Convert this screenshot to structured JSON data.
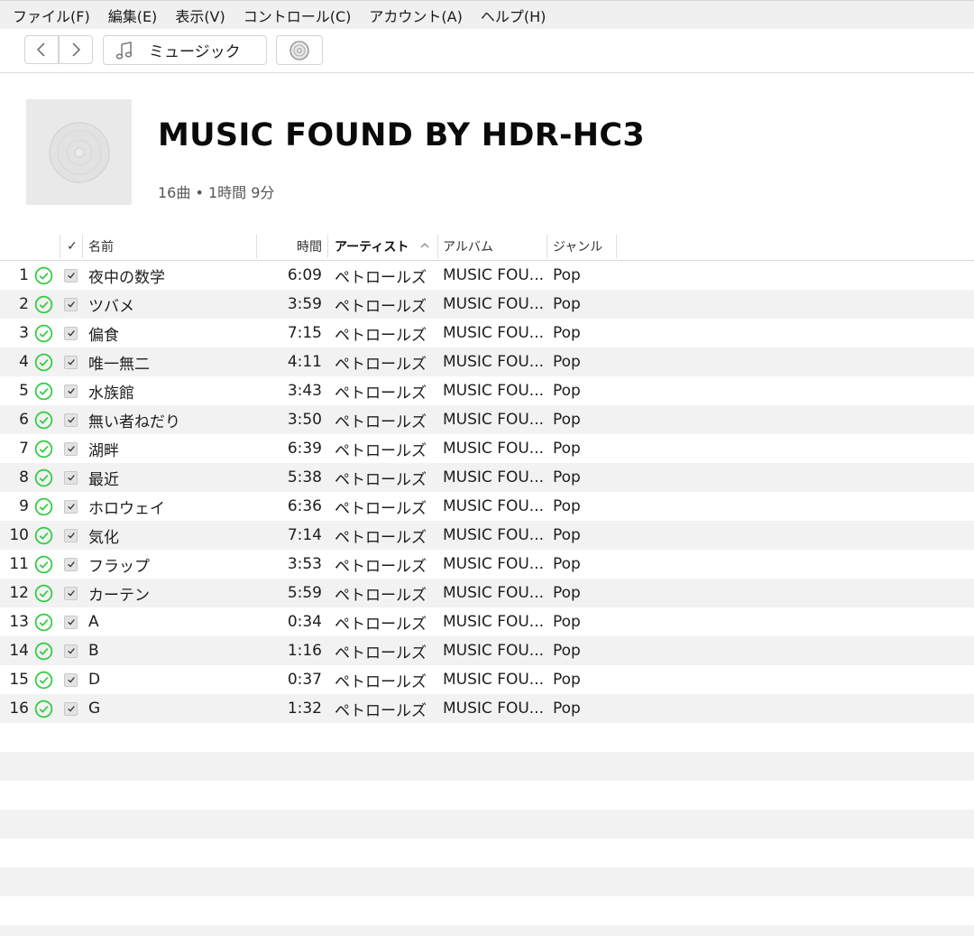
{
  "menubar": {
    "items": [
      "ファイル(F)",
      "編集(E)",
      "表示(V)",
      "コントロール(C)",
      "アカウント(A)",
      "ヘルプ(H)"
    ]
  },
  "toolbar": {
    "source_label": "ミュージック",
    "icons": [
      "chevron-left-icon",
      "chevron-right-icon",
      "music-note-icon",
      "cd-icon"
    ]
  },
  "album": {
    "title": "MUSIC FOUND BY HDR-HC3",
    "meta": "16曲 • 1時間 9分"
  },
  "table": {
    "headers": {
      "check": "✓",
      "name": "名前",
      "time": "時間",
      "artist": "アーティスト",
      "album": "アルバム",
      "genre": "ジャンル"
    },
    "sorted_by": "artist",
    "rows": [
      {
        "num": "1",
        "name": "夜中の数学",
        "time": "6:09",
        "artist": "ペトロールズ",
        "album": "MUSIC FOU...",
        "genre": "Pop"
      },
      {
        "num": "2",
        "name": "ツバメ",
        "time": "3:59",
        "artist": "ペトロールズ",
        "album": "MUSIC FOU...",
        "genre": "Pop"
      },
      {
        "num": "3",
        "name": "偏食",
        "time": "7:15",
        "artist": "ペトロールズ",
        "album": "MUSIC FOU...",
        "genre": "Pop"
      },
      {
        "num": "4",
        "name": "唯一無二",
        "time": "4:11",
        "artist": "ペトロールズ",
        "album": "MUSIC FOU...",
        "genre": "Pop"
      },
      {
        "num": "5",
        "name": "水族館",
        "time": "3:43",
        "artist": "ペトロールズ",
        "album": "MUSIC FOU...",
        "genre": "Pop"
      },
      {
        "num": "6",
        "name": "無い者ねだり",
        "time": "3:50",
        "artist": "ペトロールズ",
        "album": "MUSIC FOU...",
        "genre": "Pop"
      },
      {
        "num": "7",
        "name": "湖畔",
        "time": "6:39",
        "artist": "ペトロールズ",
        "album": "MUSIC FOU...",
        "genre": "Pop"
      },
      {
        "num": "8",
        "name": "最近",
        "time": "5:38",
        "artist": "ペトロールズ",
        "album": "MUSIC FOU...",
        "genre": "Pop"
      },
      {
        "num": "9",
        "name": "ホロウェイ",
        "time": "6:36",
        "artist": "ペトロールズ",
        "album": "MUSIC FOU...",
        "genre": "Pop"
      },
      {
        "num": "10",
        "name": "気化",
        "time": "7:14",
        "artist": "ペトロールズ",
        "album": "MUSIC FOU...",
        "genre": "Pop"
      },
      {
        "num": "11",
        "name": "フラップ",
        "time": "3:53",
        "artist": "ペトロールズ",
        "album": "MUSIC FOU...",
        "genre": "Pop"
      },
      {
        "num": "12",
        "name": "カーテン",
        "time": "5:59",
        "artist": "ペトロールズ",
        "album": "MUSIC FOU...",
        "genre": "Pop"
      },
      {
        "num": "13",
        "name": "A",
        "time": "0:34",
        "artist": "ペトロールズ",
        "album": "MUSIC FOU...",
        "genre": "Pop"
      },
      {
        "num": "14",
        "name": "B",
        "time": "1:16",
        "artist": "ペトロールズ",
        "album": "MUSIC FOU...",
        "genre": "Pop"
      },
      {
        "num": "15",
        "name": "D",
        "time": "0:37",
        "artist": "ペトロールズ",
        "album": "MUSIC FOU...",
        "genre": "Pop"
      },
      {
        "num": "16",
        "name": "G",
        "time": "1:32",
        "artist": "ペトロールズ",
        "album": "MUSIC FOU...",
        "genre": "Pop"
      }
    ]
  },
  "colors": {
    "status_green": "#2ecc40",
    "row_alt": "#f2f2f2",
    "menubar_bg": "#f0f0f0"
  }
}
